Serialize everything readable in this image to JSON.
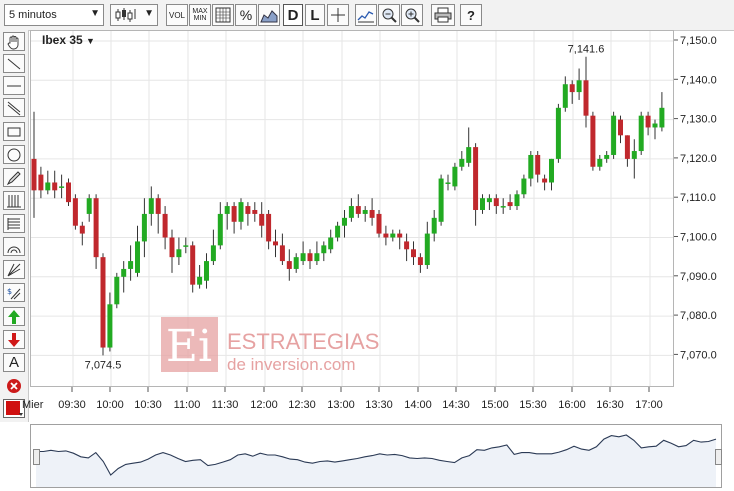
{
  "toolbar": {
    "interval": "5 minutos",
    "vol": "VOL",
    "max": "MAX",
    "min": "MIN",
    "pct": "%",
    "d": "D",
    "l": "L",
    "help": "?"
  },
  "chart": {
    "symbol": "Ibex 35",
    "watermark_brand": "ESTRATEGIAS",
    "watermark_sub": "de inversion.com",
    "max_label": "7,141.6",
    "min_label": "7,074.5",
    "side_a_label": "A"
  },
  "colors": {
    "up": "#22aa22",
    "down": "#c0282d",
    "accent": "#d01010",
    "watermark": "#e6a2a2"
  },
  "chart_data": {
    "type": "candlestick",
    "ylim": [
      7062,
      7153
    ],
    "y_ticks": [
      "7,150.0",
      "7,140.0",
      "7,130.0",
      "7,120.0",
      "7,110.0",
      "7,100.0",
      "7,090.0",
      "7,080.0",
      "7,070.0"
    ],
    "x_ticks": [
      "Mier",
      "09:30",
      "10:00",
      "10:30",
      "11:00",
      "11:30",
      "12:00",
      "12:30",
      "13:00",
      "13:30",
      "14:00",
      "14:30",
      "15:00",
      "15:30",
      "16:00",
      "16:30",
      "17:00"
    ],
    "candles": [
      [
        7120,
        7112,
        7132,
        7105
      ],
      [
        7116,
        7112,
        7118,
        7110
      ],
      [
        7112,
        7114,
        7117,
        7111
      ],
      [
        7114,
        7112,
        7117,
        7110
      ],
      [
        7113,
        7113,
        7116,
        7110
      ],
      [
        7114,
        7109,
        7115,
        7108
      ],
      [
        7110,
        7103,
        7111,
        7102
      ],
      [
        7103,
        7101,
        7104,
        7098
      ],
      [
        7106,
        7110,
        7111,
        7104
      ],
      [
        7110,
        7095,
        7111,
        7092
      ],
      [
        7095,
        7072,
        7096,
        7070
      ],
      [
        7072,
        7083,
        7086,
        7071
      ],
      [
        7083,
        7090,
        7091,
        7082
      ],
      [
        7090,
        7092,
        7094,
        7086
      ],
      [
        7092,
        7094,
        7098,
        7089
      ],
      [
        7091,
        7099,
        7103,
        7090
      ],
      [
        7099,
        7106,
        7110,
        7095
      ],
      [
        7106,
        7110,
        7113,
        7103
      ],
      [
        7110,
        7106,
        7111,
        7101
      ],
      [
        7106,
        7100,
        7108,
        7097
      ],
      [
        7100,
        7095,
        7102,
        7091
      ],
      [
        7095,
        7097,
        7100,
        7093
      ],
      [
        7098,
        7098,
        7100,
        7096
      ],
      [
        7098,
        7088,
        7099,
        7086
      ],
      [
        7088,
        7090,
        7093,
        7087
      ],
      [
        7089,
        7094,
        7096,
        7087
      ],
      [
        7094,
        7098,
        7102,
        7093
      ],
      [
        7098,
        7106,
        7109,
        7097
      ],
      [
        7106,
        7108,
        7109,
        7102
      ],
      [
        7108,
        7104,
        7109,
        7101
      ],
      [
        7104,
        7109,
        7110,
        7102
      ],
      [
        7108,
        7106,
        7109,
        7103
      ],
      [
        7107,
        7106,
        7109,
        7104
      ],
      [
        7106,
        7103,
        7109,
        7100
      ],
      [
        7106,
        7099,
        7107,
        7097
      ],
      [
        7099,
        7098,
        7102,
        7095
      ],
      [
        7098,
        7094,
        7101,
        7093
      ],
      [
        7094,
        7092,
        7097,
        7089
      ],
      [
        7092,
        7095,
        7096,
        7091
      ],
      [
        7094,
        7096,
        7099,
        7093
      ],
      [
        7096,
        7094,
        7097,
        7092
      ],
      [
        7094,
        7096,
        7099,
        7093
      ],
      [
        7096,
        7098,
        7099,
        7094
      ],
      [
        7097,
        7100,
        7102,
        7096
      ],
      [
        7100,
        7103,
        7104,
        7099
      ],
      [
        7103,
        7105,
        7107,
        7100
      ],
      [
        7105,
        7108,
        7110,
        7104
      ],
      [
        7108,
        7106,
        7111,
        7105
      ],
      [
        7106,
        7107,
        7108,
        7104
      ],
      [
        7107,
        7105,
        7110,
        7103
      ],
      [
        7106,
        7101,
        7107,
        7100
      ],
      [
        7101,
        7100,
        7103,
        7098
      ],
      [
        7100,
        7101,
        7102,
        7099
      ],
      [
        7101,
        7100,
        7102,
        7097
      ],
      [
        7099,
        7097,
        7101,
        7094
      ],
      [
        7097,
        7095,
        7099,
        7093
      ],
      [
        7095,
        7093,
        7096,
        7091
      ],
      [
        7093,
        7101,
        7104,
        7092
      ],
      [
        7101,
        7105,
        7107,
        7099
      ],
      [
        7104,
        7115,
        7116,
        7103
      ],
      [
        7114,
        7114,
        7116,
        7112
      ],
      [
        7113,
        7118,
        7119,
        7112
      ],
      [
        7118,
        7120,
        7122,
        7117
      ],
      [
        7119,
        7123,
        7128,
        7118
      ],
      [
        7123,
        7107,
        7124,
        7103
      ],
      [
        7107,
        7110,
        7111,
        7106
      ],
      [
        7109,
        7110,
        7111,
        7107
      ],
      [
        7110,
        7108,
        7111,
        7106
      ],
      [
        7108,
        7108,
        7110,
        7106
      ],
      [
        7109,
        7108,
        7111,
        7107
      ],
      [
        7108,
        7111,
        7112,
        7107
      ],
      [
        7111,
        7115,
        7116,
        7110
      ],
      [
        7115,
        7121,
        7122,
        7113
      ],
      [
        7121,
        7116,
        7122,
        7114
      ],
      [
        7115,
        7114,
        7116,
        7112
      ],
      [
        7114,
        7120,
        7120,
        7112
      ],
      [
        7120,
        7133,
        7134,
        7119
      ],
      [
        7133,
        7139,
        7141,
        7132
      ],
      [
        7139,
        7137,
        7140,
        7134
      ],
      [
        7137,
        7140,
        7143,
        7135
      ],
      [
        7140,
        7131,
        7146,
        7128
      ],
      [
        7131,
        7118,
        7132,
        7117
      ],
      [
        7118,
        7120,
        7121,
        7117
      ],
      [
        7120,
        7121,
        7122,
        7119
      ],
      [
        7121,
        7131,
        7132,
        7120
      ],
      [
        7130,
        7126,
        7131,
        7124
      ],
      [
        7126,
        7120,
        7126,
        7118
      ],
      [
        7120,
        7122,
        7125,
        7115
      ],
      [
        7122,
        7131,
        7132,
        7121
      ],
      [
        7131,
        7128,
        7132,
        7126
      ],
      [
        7128,
        7129,
        7130,
        7125
      ],
      [
        7128,
        7133,
        7137,
        7127
      ]
    ]
  }
}
